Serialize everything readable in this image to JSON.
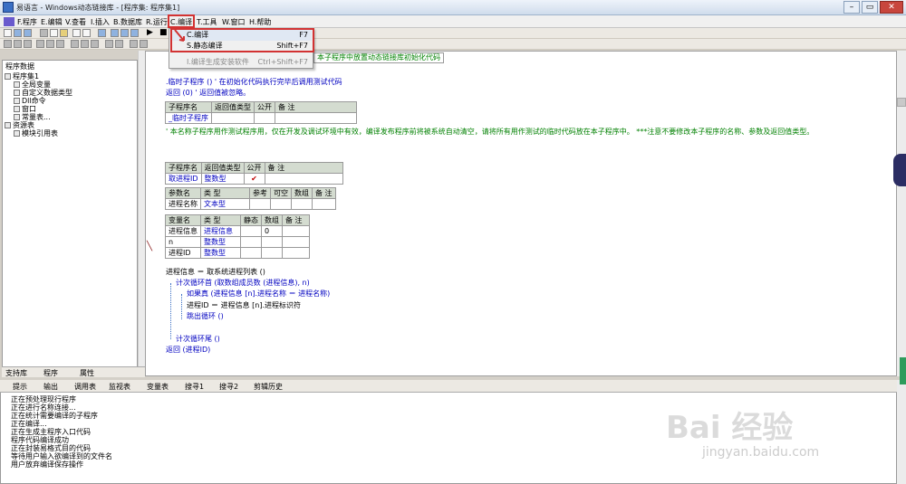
{
  "window": {
    "title": "易语言 - Windows动态链接库 - [程序集: 程序集1]",
    "minimize": "–",
    "maximize": "▭",
    "close": "✕"
  },
  "menubar": {
    "items": [
      "F.程序",
      "E.编辑",
      "V.查看",
      "I.插入",
      "B.数据库",
      "R.运行",
      "C.编译",
      "T.工具",
      "W.窗口",
      "H.帮助"
    ]
  },
  "compile_menu": {
    "items": [
      {
        "label": "C.编译",
        "shortcut": "F7"
      },
      {
        "label": "S.静态编译",
        "shortcut": "Shift+F7"
      },
      {
        "label": "I.编译生成安装软件",
        "shortcut": "Ctrl+Shift+F7"
      }
    ]
  },
  "left_panel": {
    "title": "程序数据",
    "items": [
      "程序集1",
      "全局变量",
      "自定义数据类型",
      "Dll命令",
      "窗口",
      "常量表...",
      "资源表",
      "模块引用表"
    ],
    "tabs": [
      "支持库",
      "程序",
      "属性"
    ]
  },
  "editor": {
    "banner": "本子程序中放置动态链接库初始化代码",
    "line_sub1": ".临时子程序 ()  ' 在初始化代码执行完毕后调用测试代码",
    "line_ret0": "返回 (0)  ' 返回值被忽略。",
    "t1_headers": [
      "子程序名",
      "返回值类型",
      "公开",
      "备 注"
    ],
    "t1_row": [
      "_临时子程序",
      "",
      "",
      ""
    ],
    "comment": "' 本名称子程序用作测试程序用，仅在开发及调试环境中有效，编译发布程序前将被系统自动清空，请将所有用作测试的临时代码放在本子程序中。 ***注意不要修改本子程序的名称、参数及返回值类型。",
    "t2_headers": [
      "子程序名",
      "返回值类型",
      "公开",
      "备 注"
    ],
    "t2_row": [
      "取进程ID",
      "整数型",
      "✔",
      ""
    ],
    "t2_param_headers": [
      "参数名",
      "类 型",
      "参考",
      "可空",
      "数组",
      "备 注"
    ],
    "t2_param_row": [
      "进程名称",
      "文本型",
      "",
      "",
      "",
      ""
    ],
    "t3_headers": [
      "变量名",
      "类 型",
      "静态",
      "数组",
      "备 注"
    ],
    "t3_rows": [
      [
        "进程信息",
        "进程信息",
        "",
        "0",
        ""
      ],
      [
        "n",
        "整数型",
        "",
        "",
        ""
      ],
      [
        "进程ID",
        "整数型",
        "",
        "",
        ""
      ]
    ],
    "code": [
      "进程信息 ＝ 取系统进程列表 ()",
      "计次循环首 (取数组成员数 (进程信息), n)",
      "如果真 (进程信息 [n].进程名称 ＝ 进程名称)",
      "进程ID ＝ 进程信息 [n].进程标识符",
      "跳出循环 ()",
      "计次循环尾 ()",
      "返回 (进程ID)"
    ]
  },
  "bottom_tabs": [
    "提示",
    "输出",
    "调用表",
    "监视表",
    "变量表",
    "搜寻1",
    "搜寻2",
    "剪辑历史"
  ],
  "output_lines": [
    "正在预处理现行程序",
    "正在进行名称连接...",
    "正在统计需要编译的子程序",
    "正在编译...",
    "正在生成主程序入口代码",
    "程序代码编译成功",
    "正在封装易格式目的代码",
    "等待用户输入欲编译到的文件名",
    "用户放弃编译保存操作"
  ],
  "watermark": {
    "brand": "Bai 经验",
    "url": "jingyan.baidu.com"
  },
  "colors": {
    "highlight": "#d23232",
    "keyword": "#0000c0",
    "comment": "#008000"
  }
}
